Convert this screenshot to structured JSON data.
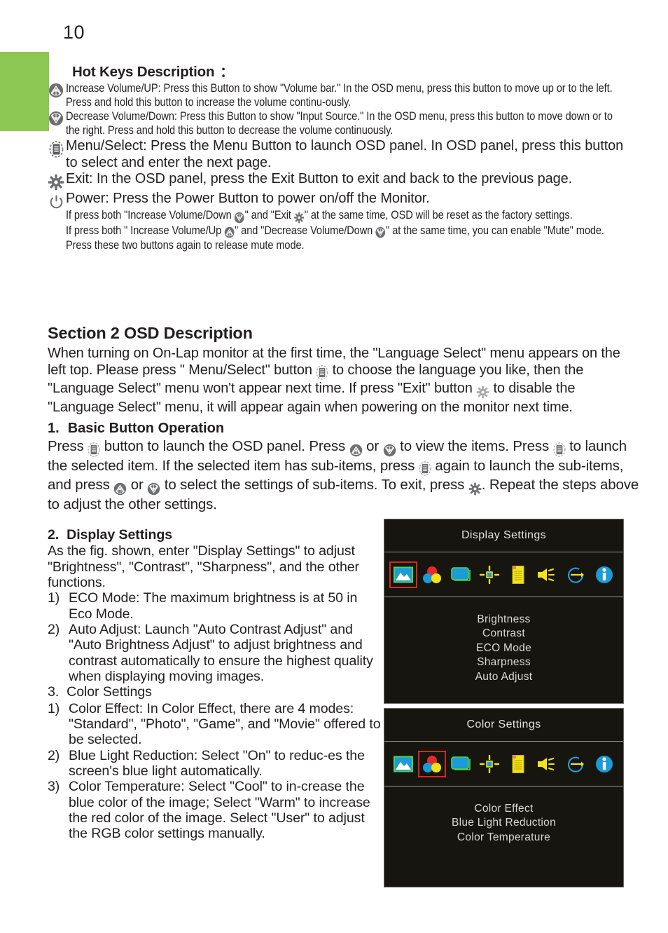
{
  "page": {
    "number": "10",
    "accent_green": "#8CC653",
    "text_color": "#231f20"
  },
  "hotkeys": {
    "heading": "Hot Keys Description",
    "heading_colon": "：",
    "items": [
      {
        "icon": "volume-up-icon",
        "text": "Increase Volume/UP: Press this Button to show \"Volume bar.\" In the OSD menu, press this button to move up or to the left. Press  and hold  this button to  increase the volume continu-ously."
      },
      {
        "icon": "volume-down-icon",
        "text": "Decrease Volume/Down: Press this Button to show \"Input Source.\" In the OSD menu, press this button to move down or to the right. Press and hold  this button to decrease the volume continuously."
      },
      {
        "icon": "menu-icon",
        "text": "Menu/Select: Press the Menu Button to launch OSD panel. In OSD panel, press this button to select and enter the next page."
      },
      {
        "icon": "gear-icon",
        "text": "Exit: In the OSD panel, press the Exit Button to exit and back to the previous page."
      },
      {
        "icon": "power-icon",
        "text": "Power: Press the Power Button to power on/off the Monitor."
      }
    ],
    "power_notes": [
      {
        "part1": "If press  both \"Increase Volume/Down ",
        "icon1": "volume-down-icon",
        "part2": "\" and \"Exit ",
        "icon2": "gear-icon",
        "part3": "\" at the same time, OSD will be reset as the factory settings."
      },
      {
        "part1": "If press both \" Increase Volume/Up ",
        "icon1": "volume-up-icon",
        "part2": "\" and \"Decrease Volume/Down ",
        "icon2": "volume-down-icon",
        "part3": "\" at the same time, you can enable \"Mute\" mode. Press these two buttons again to release mute mode."
      }
    ]
  },
  "section2": {
    "heading": "Section 2  OSD Description",
    "intro_part1": "When turning on On-Lap monitor at the first time, the \"Language Select\" menu appears  on the left top. Please press \" Menu/Select\" button ",
    "intro_icon1": "menu-icon",
    "intro_part2": " to choose the language you like, then the \"Language Select\" menu won't appear next time. If press \"Exit\" button ",
    "intro_icon2": "gear-icon",
    "intro_part3": " to disable the \"Language Select\" menu, it will appear again when powering on the monitor next time."
  },
  "basic_button_operation": {
    "number": "1.",
    "heading": "Basic Button Operation",
    "body_p1": "Press ",
    "body_icon1": "menu-icon",
    "body_p2": " button to launch the OSD panel. Press ",
    "body_icon2": "volume-up-icon",
    "body_p3": " or ",
    "body_icon3": "volume-down-icon",
    "body_p4": " to view the items. Press ",
    "body_icon4": "menu-icon",
    "body_p5": " to launch the selected item. If the selected item has sub-items, press ",
    "body_icon5": "menu-icon",
    "body_p6": " again to launch the sub-items, and press ",
    "body_icon6": "volume-up-icon",
    "body_p7": " or ",
    "body_icon7": "volume-down-icon",
    "body_p8": " to select the settings of sub-items. To exit, press ",
    "body_icon8": "gear-icon",
    "body_p9": ". Repeat the steps above to adjust the other settings."
  },
  "display_settings_text": {
    "number": "2.",
    "heading": "Display Settings",
    "intro": "As the fig. shown, enter \"Display Settings\" to adjust \"Brightness\", \"Contrast\",  \"Sharpness\", and the other functions.",
    "items": [
      {
        "marker": "1)",
        "text": "ECO Mode: The maximum brightness is at 50 in Eco Mode."
      },
      {
        "marker": "2)",
        "text": "Auto Adjust: Launch \"Auto Contrast Adjust\" and \"Auto Brightness Adjust\" to adjust brightness and contrast automatically to ensure the highest quality when displaying moving images."
      }
    ]
  },
  "color_settings_text": {
    "number": "3.",
    "heading": "Color Settings",
    "items": [
      {
        "marker": "1)",
        "text": "Color Effect: In Color Effect, there are 4 modes: \"Standard\", \"Photo\", \"Game\", and \"Movie\" offered to be selected."
      },
      {
        "marker": "2)",
        "text": "Blue Light Reduction: Select \"On\" to reduc-es the screen's blue light automatically."
      },
      {
        "marker": "3)",
        "text": "Color Temperature: Select \"Cool\" to in-crease the blue color of the image; Select \"Warm\" to increase the red color of the image. Select \"User\" to adjust the RGB color settings manually."
      }
    ]
  },
  "osd_display_panel": {
    "title": "Display Settings",
    "selected_icon_index": 0,
    "icons": [
      "picture-icon",
      "color-circles-icon",
      "screen-icon",
      "brightness-cross-icon",
      "document-icon",
      "speaker-icon",
      "reset-icon",
      "info-icon"
    ],
    "items": [
      "Brightness",
      "Contrast",
      "ECO Mode",
      "Sharpness",
      "Auto Adjust"
    ]
  },
  "osd_color_panel": {
    "title": "Color  Settings",
    "selected_icon_index": 1,
    "icons": [
      "picture-icon",
      "color-circles-icon",
      "screen-icon",
      "brightness-cross-icon",
      "document-icon",
      "speaker-icon",
      "reset-icon",
      "info-icon"
    ],
    "items": [
      "Color Effect",
      "Blue Light Reduction",
      "Color Temperature"
    ]
  }
}
